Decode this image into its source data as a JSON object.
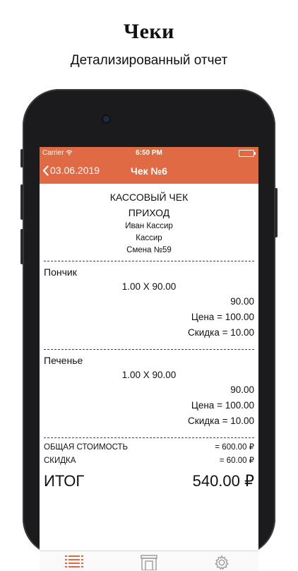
{
  "promo": {
    "title": "Чеки",
    "subtitle": "Детализированный отчет"
  },
  "statusbar": {
    "carrier": "Carrier",
    "time": "6:50 PM"
  },
  "navbar": {
    "back_label": "03.06.2019",
    "title": "Чек №6"
  },
  "receipt": {
    "title": "КАССОВЫЙ ЧЕК",
    "type": "ПРИХОД",
    "cashier_name": "Иван Кассир",
    "cashier_role": "Кассир",
    "shift": "Смена №59",
    "items": [
      {
        "name": "Пончик",
        "quantity_line": "1.00 X 90.00",
        "amount": "90.00",
        "price_line": "Цена = 100.00",
        "discount_line": "Скидка = 10.00"
      },
      {
        "name": "Печенье",
        "quantity_line": "1.00 X 90.00",
        "amount": "90.00",
        "price_line": "Цена = 100.00",
        "discount_line": "Скидка = 10.00"
      }
    ],
    "summary": {
      "total_cost_label": "ОБЩАЯ СТОИМОСТЬ",
      "total_cost_value": "= 600.00 ₽",
      "discount_label": "СКИДКА",
      "discount_value": "= 60.00 ₽",
      "grand_total_label": "ИТОГ",
      "grand_total_value": "540.00 ₽"
    }
  },
  "tabbar": {
    "icons": [
      "list-icon",
      "store-icon",
      "gear-icon"
    ]
  },
  "colors": {
    "accent": "#e06a43"
  }
}
